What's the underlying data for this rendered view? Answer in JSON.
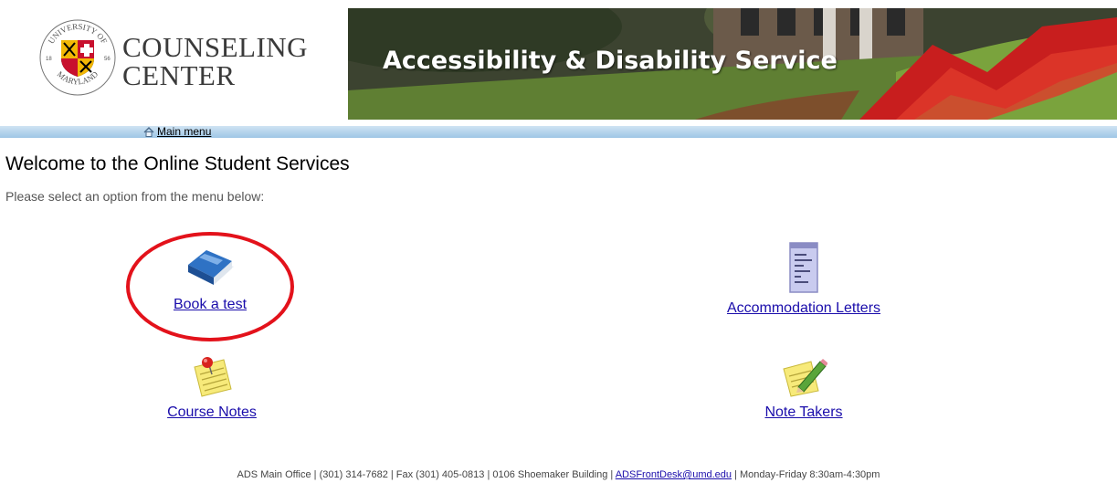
{
  "header": {
    "logo_line1": "COUNSELING",
    "logo_line2": "CENTER",
    "seal_text_top": "UNIVERSITY OF",
    "seal_text_bottom": "MARYLAND",
    "seal_year_left": "18",
    "seal_year_right": "56",
    "banner_title": "Accessibility & Disability Service"
  },
  "nav": {
    "main_menu": "Main menu"
  },
  "main": {
    "welcome": "Welcome to the Online Student Services",
    "instructions": "Please select an option from the menu below:",
    "options": [
      {
        "label": "Book a test",
        "icon": "blue-book-icon"
      },
      {
        "label": "Accommodation Letters",
        "icon": "document-list-icon"
      },
      {
        "label": "Course Notes",
        "icon": "pinned-note-icon"
      },
      {
        "label": "Note Takers",
        "icon": "note-pencil-icon"
      }
    ]
  },
  "footer": {
    "text_before": "ADS Main Office | (301) 314-7682 | Fax (301) 405-0813 | 0106 Shoemaker Building | ",
    "email": "ADSFrontDesk@umd.edu",
    "text_after": " | Monday-Friday 8:30am-4:30pm"
  },
  "colors": {
    "link": "#1a0dab",
    "highlight_ring": "#e3121b",
    "navbar": "#9ec6e6"
  }
}
